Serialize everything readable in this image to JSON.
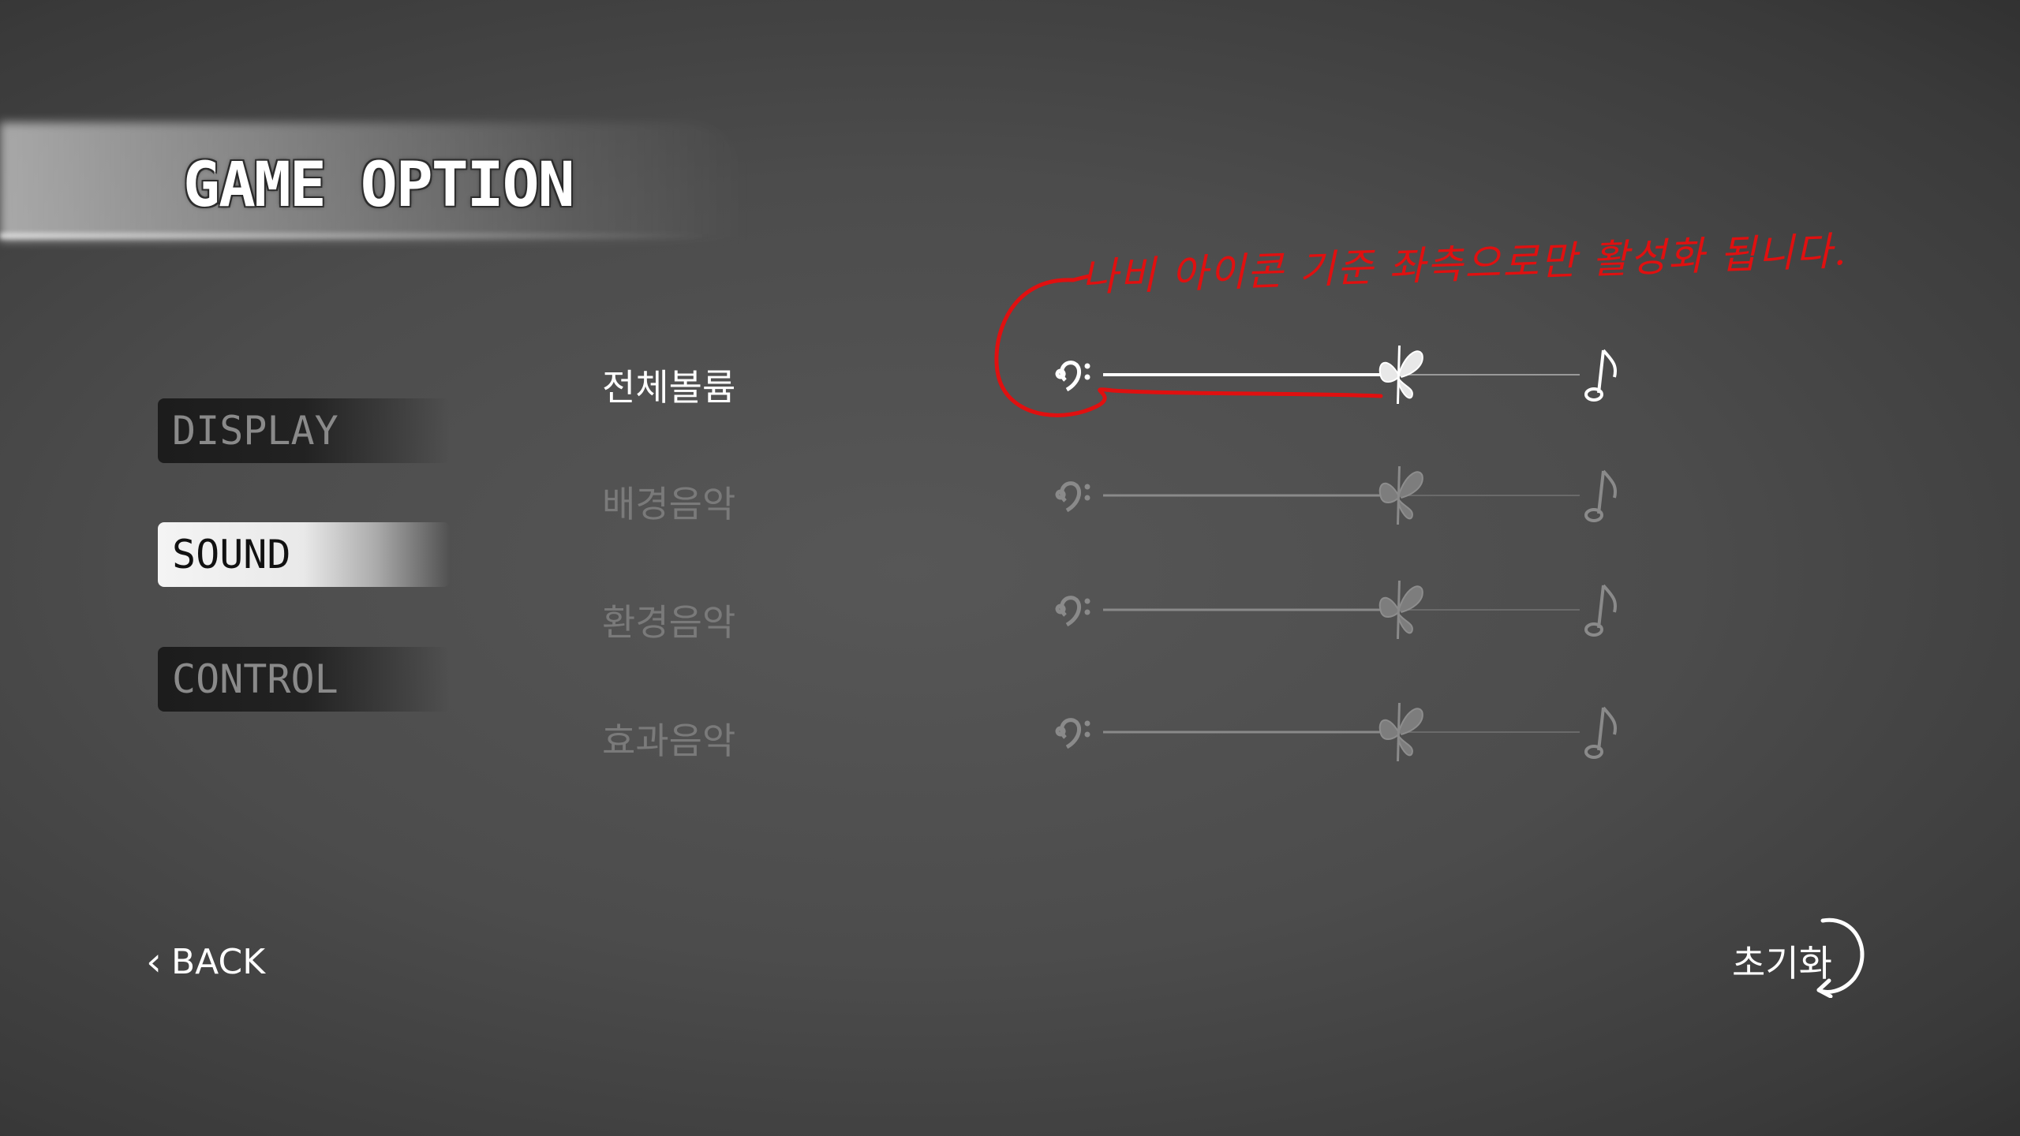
{
  "header": {
    "title": "GAME OPTION"
  },
  "menu": {
    "items": [
      {
        "label": "DISPLAY",
        "state": "inactive"
      },
      {
        "label": "SOUND",
        "state": "active"
      },
      {
        "label": "CONTROL",
        "state": "inactive"
      }
    ]
  },
  "sound": {
    "sliders": [
      {
        "label": "전체볼륨",
        "value": 0.62,
        "enabled": true
      },
      {
        "label": "배경음악",
        "value": 0.62,
        "enabled": false
      },
      {
        "label": "환경음악",
        "value": 0.62,
        "enabled": false
      },
      {
        "label": "효과음악",
        "value": 0.62,
        "enabled": false
      }
    ],
    "min_icon": "bass-clef-icon",
    "max_icon": "eighth-note-icon",
    "thumb_icon": "butterfly-icon"
  },
  "annotation": {
    "text": "나비 아이콘 기준 좌측으로만 활성화 됩니다."
  },
  "footer": {
    "back_label": "BACK",
    "reset_label": "초기화"
  },
  "colors": {
    "annotation": "#e01010",
    "active_text": "#ffffff",
    "disabled_text": "#7a7a7a"
  }
}
